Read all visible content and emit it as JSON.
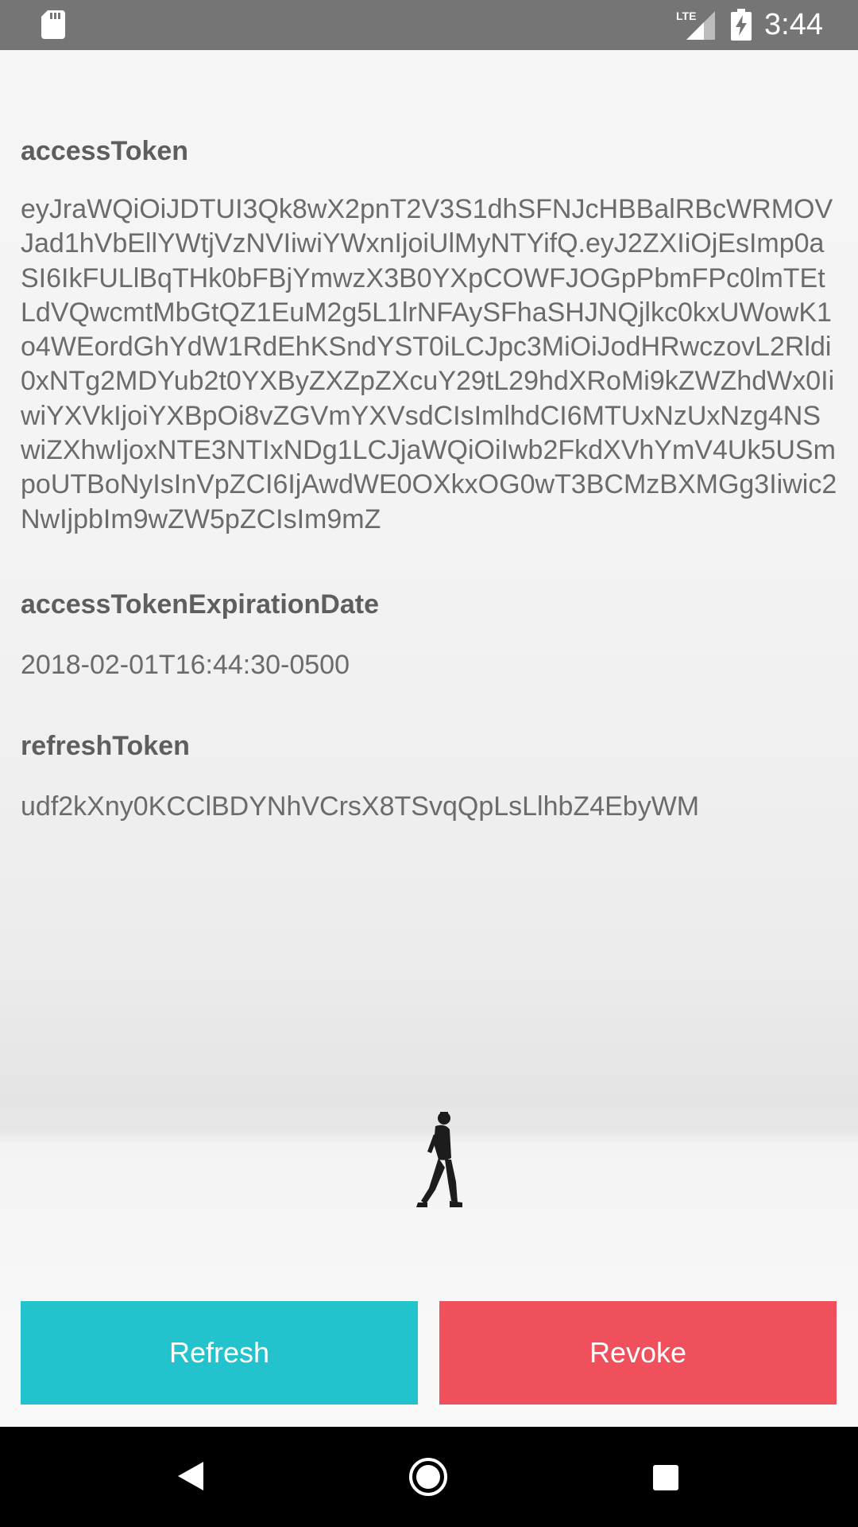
{
  "status_bar": {
    "time": "3:44",
    "network": "LTE",
    "icons": [
      "sd-card-icon",
      "lte-signal-icon",
      "battery-charging-icon"
    ]
  },
  "fields": {
    "access_token": {
      "label": "accessToken",
      "value": "eyJraWQiOiJDTUI3Qk8wX2pnT2V3S1dhSFNJcHBBalRBcWRMOVJad1hVbEllYWtjVzNVIiwiYWxnIjoiUlMyNTYifQ.eyJ2ZXIiOjEsImp0aSI6IkFULlBqTHk0bFBjYmwzX3B0YXpCOWFJOGpPbmFPc0lmTEtLdVQwcmtMbGtQZ1EuM2g5L1lrNFAySFhaSHJNQjlkc0kxUWowK1o4WEordGhYdW1RdEhKSndYST0iLCJpc3MiOiJodHRwczovL2Rldi0xNTg2MDYub2t0YXByZXZpZXcuY29tL29hdXRoMi9kZWZhdWx0IiwiYXVkIjoiYXBpOi8vZGVmYXVsdCIsImlhdCI6MTUxNzUxNzg4NSwiZXhwIjoxNTE3NTIxNDg1LCJjaWQiOiIwb2FkdXVhYmV4Uk5USmpoUTBoNyIsInVpZCI6IjAwdWE0OXkxOG0wT3BCMzBXMGg3Iiwic2NwIjpbIm9wZW5pZCIsIm9mZ"
    },
    "expiration": {
      "label": "accessTokenExpirationDate",
      "value": "2018-02-01T16:44:30-0500"
    },
    "refresh_token": {
      "label": "refreshToken",
      "value": "udf2kXny0KCClBDYNhVCrsX8TSvqQpLsLlhbZ4EbyWM"
    }
  },
  "buttons": {
    "refresh_label": "Refresh",
    "revoke_label": "Revoke"
  },
  "colors": {
    "status_bar": "#757575",
    "refresh_button": "#22c3cd",
    "revoke_button": "#f0505c",
    "label_text": "#5e5e5e",
    "value_text": "#6b6b6b",
    "nav_bar": "#000000"
  },
  "nav_bar": {
    "icons": [
      "back-icon",
      "home-icon",
      "recents-icon"
    ]
  }
}
